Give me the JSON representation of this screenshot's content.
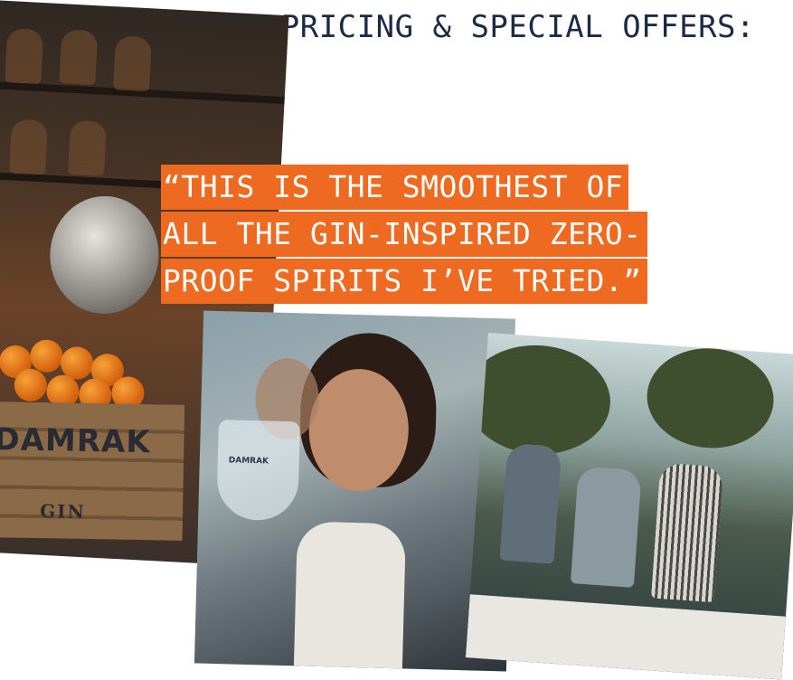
{
  "header": {
    "title": "Pricing & Special Offers:"
  },
  "testimonial": {
    "lines": [
      "“This is the smoothest of",
      "all the gin-inspired zero-",
      "proof spirits I’ve tried.”"
    ]
  },
  "photos": {
    "distillery": {
      "crate_brand": "DAMRAK",
      "crate_sub": "GIN"
    },
    "woman": {
      "glass_label": "DAMRAK"
    }
  },
  "colors": {
    "accent": "#ee6a21",
    "heading": "#1c2a45"
  }
}
